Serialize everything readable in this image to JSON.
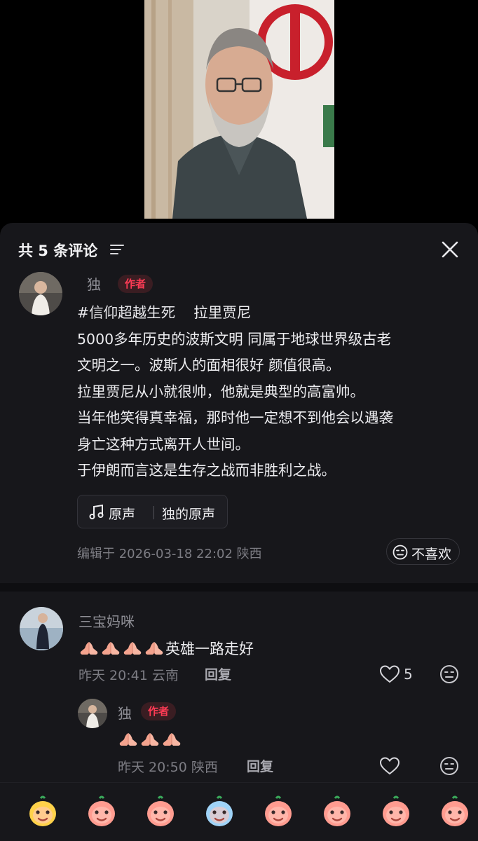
{
  "sheet": {
    "title": "共 5 条评论"
  },
  "post": {
    "author": "独",
    "badge": "作者",
    "hashtag": "#信仰超越生死",
    "title_rest": "拉里贾尼",
    "lines": [
      "5000多年历史的波斯文明 同属于地球世界级古老",
      "文明之一。波斯人的面相很好 颜值很高。",
      "拉里贾尼从小就很帅，他就是典型的高富帅。",
      "当年他笑得真幸福，那时他一定想不到他会以遇袭",
      "身亡这种方式离开人世间。",
      "于伊朗而言这是生存之战而非胜利之战。"
    ],
    "sound_label": "原声",
    "sound_name": "独的原声",
    "edited": "编辑于  2026-03-18 22:02  陕西",
    "dislike_label": "不喜欢"
  },
  "comments": [
    {
      "user": "三宝妈咪",
      "pray_count": 4,
      "text": "英雄一路走好",
      "time_loc": "昨天 20:41 云南",
      "reply_label": "回复",
      "likes": "5"
    }
  ],
  "reply": {
    "user": "独",
    "badge": "作者",
    "pray_count": 3,
    "time_loc": "昨天 20:50 陕西",
    "reply_label": "回复"
  },
  "emoji_bar": {
    "items": [
      "smile-face",
      "shy-face",
      "tears-laugh-face",
      "crying-face",
      "wink-face",
      "grimace-face",
      "blush-face",
      "sob-face"
    ]
  },
  "colors": {
    "sheet_bg": "#17171b",
    "badge_text": "#ff3b55",
    "badge_bg": "#3a1d22",
    "muted": "#7c7c83"
  }
}
